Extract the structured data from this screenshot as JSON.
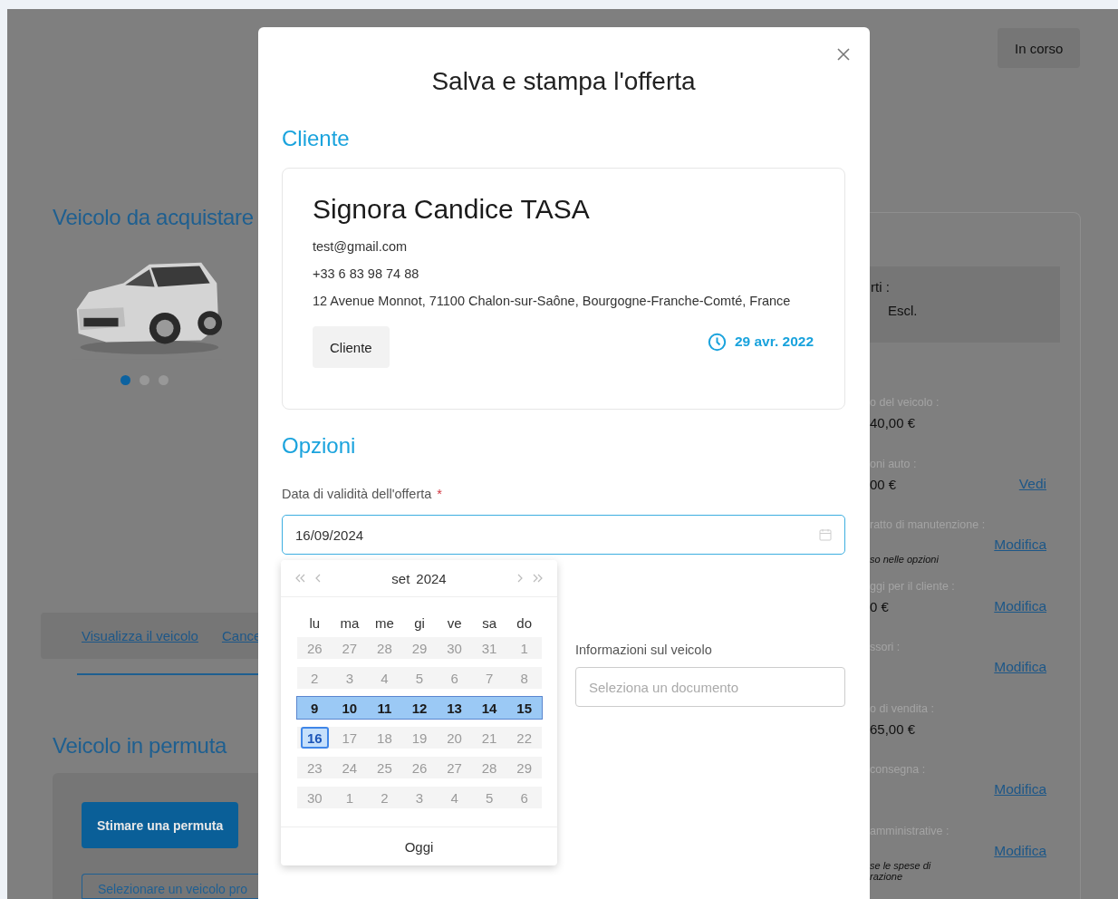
{
  "page": {
    "status_button": "In corso",
    "vehicle_section": {
      "title": "Veicolo da acquistare",
      "carousel": [
        {
          "selected": true
        },
        {
          "selected": false
        },
        {
          "selected": false
        }
      ],
      "links": [
        "Visualizza il veicolo",
        "Cance"
      ]
    },
    "trade_in": {
      "title": "Veicolo in permuta",
      "buttons": [
        {
          "label": "Stimare una permuta",
          "kind": "primary"
        },
        {
          "label": "Selezionare un veicolo pro",
          "kind": "outline"
        }
      ]
    },
    "summary": {
      "box": {
        "label": "rti :",
        "value": "Escl."
      },
      "rows": [
        {
          "label": "o del veicolo :",
          "value": "40,00 €"
        },
        {
          "label": "oni auto :",
          "value": "00 €",
          "link": "Vedi"
        },
        {
          "label": "ratto di manutenzione :",
          "link": "Modifica",
          "note": "so nelle opzioni"
        },
        {
          "label": "ggi per il cliente :",
          "value": "0 €",
          "link": "Modifica"
        },
        {
          "label": "ssori :",
          "link": "Modifica"
        },
        {
          "label": "o di vendita :",
          "value": "65,00 €"
        },
        {
          "label": "consegna :",
          "link": "Modifica"
        },
        {
          "label": "amministrative :",
          "link": "Modifica",
          "note": "se le spese di\nrazione"
        }
      ]
    }
  },
  "modal": {
    "title": "Salva e stampa l'offerta",
    "client_section": {
      "heading": "Cliente",
      "name": "Signora Candice TASA",
      "email": "test@gmail.com",
      "phone": "+33 6 83 98 74 88",
      "address": "12 Avenue Monnot, 71100 Chalon-sur-Saône, Bourgogne-Franche-Comté, France",
      "tag": "Cliente",
      "date": "29 avr. 2022"
    },
    "options_section": {
      "heading": "Opzioni",
      "validity_field": {
        "label": "Data di validità dell'offerta",
        "required_mark": "*",
        "value": "16/09/2024"
      },
      "vehicle_info_field": {
        "label": "Informazioni sul veicolo",
        "placeholder": "Seleziona un documento"
      }
    },
    "date_picker": {
      "month": "set",
      "year": "2024",
      "weekdays": [
        "lu",
        "ma",
        "me",
        "gi",
        "ve",
        "sa",
        "do"
      ],
      "today_button": "Oggi",
      "weeks": [
        {
          "highlighted": false,
          "days": [
            {
              "label": "26",
              "disabled": true,
              "selected": false
            },
            {
              "label": "27",
              "disabled": true,
              "selected": false
            },
            {
              "label": "28",
              "disabled": true,
              "selected": false
            },
            {
              "label": "29",
              "disabled": true,
              "selected": false
            },
            {
              "label": "30",
              "disabled": true,
              "selected": false
            },
            {
              "label": "31",
              "disabled": true,
              "selected": false
            },
            {
              "label": "1",
              "disabled": true,
              "selected": false
            }
          ]
        },
        {
          "highlighted": false,
          "days": [
            {
              "label": "2",
              "disabled": true,
              "selected": false
            },
            {
              "label": "3",
              "disabled": true,
              "selected": false
            },
            {
              "label": "4",
              "disabled": true,
              "selected": false
            },
            {
              "label": "5",
              "disabled": true,
              "selected": false
            },
            {
              "label": "6",
              "disabled": true,
              "selected": false
            },
            {
              "label": "7",
              "disabled": true,
              "selected": false
            },
            {
              "label": "8",
              "disabled": true,
              "selected": false
            }
          ]
        },
        {
          "highlighted": true,
          "days": [
            {
              "label": "9",
              "disabled": false,
              "selected": false
            },
            {
              "label": "10",
              "disabled": false,
              "selected": false
            },
            {
              "label": "11",
              "disabled": false,
              "selected": false
            },
            {
              "label": "12",
              "disabled": false,
              "selected": false
            },
            {
              "label": "13",
              "disabled": false,
              "selected": false
            },
            {
              "label": "14",
              "disabled": false,
              "selected": false
            },
            {
              "label": "15",
              "disabled": false,
              "selected": false
            }
          ]
        },
        {
          "highlighted": false,
          "days": [
            {
              "label": "16",
              "disabled": false,
              "selected": true
            },
            {
              "label": "17",
              "disabled": true,
              "selected": false
            },
            {
              "label": "18",
              "disabled": true,
              "selected": false
            },
            {
              "label": "19",
              "disabled": true,
              "selected": false
            },
            {
              "label": "20",
              "disabled": true,
              "selected": false
            },
            {
              "label": "21",
              "disabled": true,
              "selected": false
            },
            {
              "label": "22",
              "disabled": true,
              "selected": false
            }
          ]
        },
        {
          "highlighted": false,
          "days": [
            {
              "label": "23",
              "disabled": true,
              "selected": false
            },
            {
              "label": "24",
              "disabled": true,
              "selected": false
            },
            {
              "label": "25",
              "disabled": true,
              "selected": false
            },
            {
              "label": "26",
              "disabled": true,
              "selected": false
            },
            {
              "label": "27",
              "disabled": true,
              "selected": false
            },
            {
              "label": "28",
              "disabled": true,
              "selected": false
            },
            {
              "label": "29",
              "disabled": true,
              "selected": false
            }
          ]
        },
        {
          "highlighted": false,
          "days": [
            {
              "label": "30",
              "disabled": true,
              "selected": false
            },
            {
              "label": "1",
              "disabled": true,
              "selected": false
            },
            {
              "label": "2",
              "disabled": true,
              "selected": false
            },
            {
              "label": "3",
              "disabled": true,
              "selected": false
            },
            {
              "label": "4",
              "disabled": true,
              "selected": false
            },
            {
              "label": "5",
              "disabled": true,
              "selected": false
            },
            {
              "label": "6",
              "disabled": true,
              "selected": false
            }
          ]
        }
      ]
    }
  }
}
